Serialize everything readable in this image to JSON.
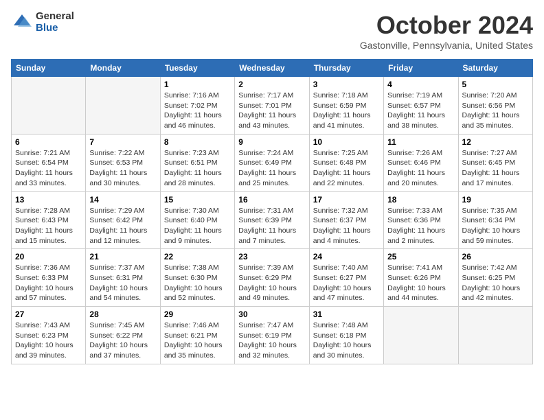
{
  "header": {
    "logo_general": "General",
    "logo_blue": "Blue",
    "month_title": "October 2024",
    "location": "Gastonville, Pennsylvania, United States"
  },
  "weekdays": [
    "Sunday",
    "Monday",
    "Tuesday",
    "Wednesday",
    "Thursday",
    "Friday",
    "Saturday"
  ],
  "weeks": [
    [
      {
        "day": "",
        "info": ""
      },
      {
        "day": "",
        "info": ""
      },
      {
        "day": "1",
        "info": "Sunrise: 7:16 AM\nSunset: 7:02 PM\nDaylight: 11 hours and 46 minutes."
      },
      {
        "day": "2",
        "info": "Sunrise: 7:17 AM\nSunset: 7:01 PM\nDaylight: 11 hours and 43 minutes."
      },
      {
        "day": "3",
        "info": "Sunrise: 7:18 AM\nSunset: 6:59 PM\nDaylight: 11 hours and 41 minutes."
      },
      {
        "day": "4",
        "info": "Sunrise: 7:19 AM\nSunset: 6:57 PM\nDaylight: 11 hours and 38 minutes."
      },
      {
        "day": "5",
        "info": "Sunrise: 7:20 AM\nSunset: 6:56 PM\nDaylight: 11 hours and 35 minutes."
      }
    ],
    [
      {
        "day": "6",
        "info": "Sunrise: 7:21 AM\nSunset: 6:54 PM\nDaylight: 11 hours and 33 minutes."
      },
      {
        "day": "7",
        "info": "Sunrise: 7:22 AM\nSunset: 6:53 PM\nDaylight: 11 hours and 30 minutes."
      },
      {
        "day": "8",
        "info": "Sunrise: 7:23 AM\nSunset: 6:51 PM\nDaylight: 11 hours and 28 minutes."
      },
      {
        "day": "9",
        "info": "Sunrise: 7:24 AM\nSunset: 6:49 PM\nDaylight: 11 hours and 25 minutes."
      },
      {
        "day": "10",
        "info": "Sunrise: 7:25 AM\nSunset: 6:48 PM\nDaylight: 11 hours and 22 minutes."
      },
      {
        "day": "11",
        "info": "Sunrise: 7:26 AM\nSunset: 6:46 PM\nDaylight: 11 hours and 20 minutes."
      },
      {
        "day": "12",
        "info": "Sunrise: 7:27 AM\nSunset: 6:45 PM\nDaylight: 11 hours and 17 minutes."
      }
    ],
    [
      {
        "day": "13",
        "info": "Sunrise: 7:28 AM\nSunset: 6:43 PM\nDaylight: 11 hours and 15 minutes."
      },
      {
        "day": "14",
        "info": "Sunrise: 7:29 AM\nSunset: 6:42 PM\nDaylight: 11 hours and 12 minutes."
      },
      {
        "day": "15",
        "info": "Sunrise: 7:30 AM\nSunset: 6:40 PM\nDaylight: 11 hours and 9 minutes."
      },
      {
        "day": "16",
        "info": "Sunrise: 7:31 AM\nSunset: 6:39 PM\nDaylight: 11 hours and 7 minutes."
      },
      {
        "day": "17",
        "info": "Sunrise: 7:32 AM\nSunset: 6:37 PM\nDaylight: 11 hours and 4 minutes."
      },
      {
        "day": "18",
        "info": "Sunrise: 7:33 AM\nSunset: 6:36 PM\nDaylight: 11 hours and 2 minutes."
      },
      {
        "day": "19",
        "info": "Sunrise: 7:35 AM\nSunset: 6:34 PM\nDaylight: 10 hours and 59 minutes."
      }
    ],
    [
      {
        "day": "20",
        "info": "Sunrise: 7:36 AM\nSunset: 6:33 PM\nDaylight: 10 hours and 57 minutes."
      },
      {
        "day": "21",
        "info": "Sunrise: 7:37 AM\nSunset: 6:31 PM\nDaylight: 10 hours and 54 minutes."
      },
      {
        "day": "22",
        "info": "Sunrise: 7:38 AM\nSunset: 6:30 PM\nDaylight: 10 hours and 52 minutes."
      },
      {
        "day": "23",
        "info": "Sunrise: 7:39 AM\nSunset: 6:29 PM\nDaylight: 10 hours and 49 minutes."
      },
      {
        "day": "24",
        "info": "Sunrise: 7:40 AM\nSunset: 6:27 PM\nDaylight: 10 hours and 47 minutes."
      },
      {
        "day": "25",
        "info": "Sunrise: 7:41 AM\nSunset: 6:26 PM\nDaylight: 10 hours and 44 minutes."
      },
      {
        "day": "26",
        "info": "Sunrise: 7:42 AM\nSunset: 6:25 PM\nDaylight: 10 hours and 42 minutes."
      }
    ],
    [
      {
        "day": "27",
        "info": "Sunrise: 7:43 AM\nSunset: 6:23 PM\nDaylight: 10 hours and 39 minutes."
      },
      {
        "day": "28",
        "info": "Sunrise: 7:45 AM\nSunset: 6:22 PM\nDaylight: 10 hours and 37 minutes."
      },
      {
        "day": "29",
        "info": "Sunrise: 7:46 AM\nSunset: 6:21 PM\nDaylight: 10 hours and 35 minutes."
      },
      {
        "day": "30",
        "info": "Sunrise: 7:47 AM\nSunset: 6:19 PM\nDaylight: 10 hours and 32 minutes."
      },
      {
        "day": "31",
        "info": "Sunrise: 7:48 AM\nSunset: 6:18 PM\nDaylight: 10 hours and 30 minutes."
      },
      {
        "day": "",
        "info": ""
      },
      {
        "day": "",
        "info": ""
      }
    ]
  ]
}
